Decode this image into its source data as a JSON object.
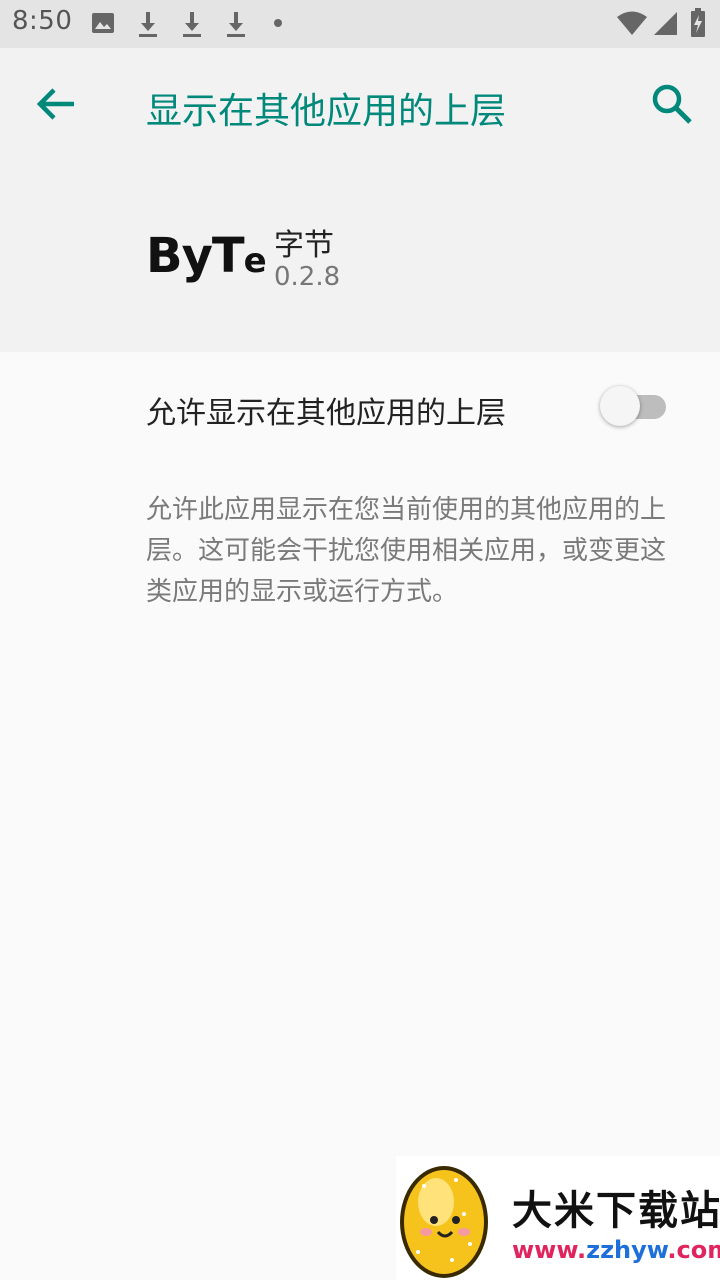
{
  "status_bar": {
    "time": "8:50",
    "icons_left": [
      "image-icon",
      "download-icon",
      "download-icon",
      "download-icon",
      "dot-icon"
    ],
    "icons_right": [
      "wifi-icon",
      "signal-icon",
      "battery-charging-icon"
    ]
  },
  "toolbar": {
    "title": "显示在其他应用的上层",
    "back_icon": "arrow-left-icon",
    "search_icon": "search-icon",
    "accent_color": "#00897b"
  },
  "app": {
    "logo_text_big": "ByT",
    "logo_text_small": "e",
    "name": "字节",
    "version": "0.2.8"
  },
  "setting": {
    "label": "允许显示在其他应用的上层",
    "enabled": false,
    "description": "允许此应用显示在您当前使用的其他应用的上层。这可能会干扰您使用相关应用，或变更这类应用的显示或运行方式。"
  },
  "watermark": {
    "title": "大米下载站",
    "url_part1": "www.",
    "url_part2": "zzhyw",
    "url_part3": ".com"
  }
}
